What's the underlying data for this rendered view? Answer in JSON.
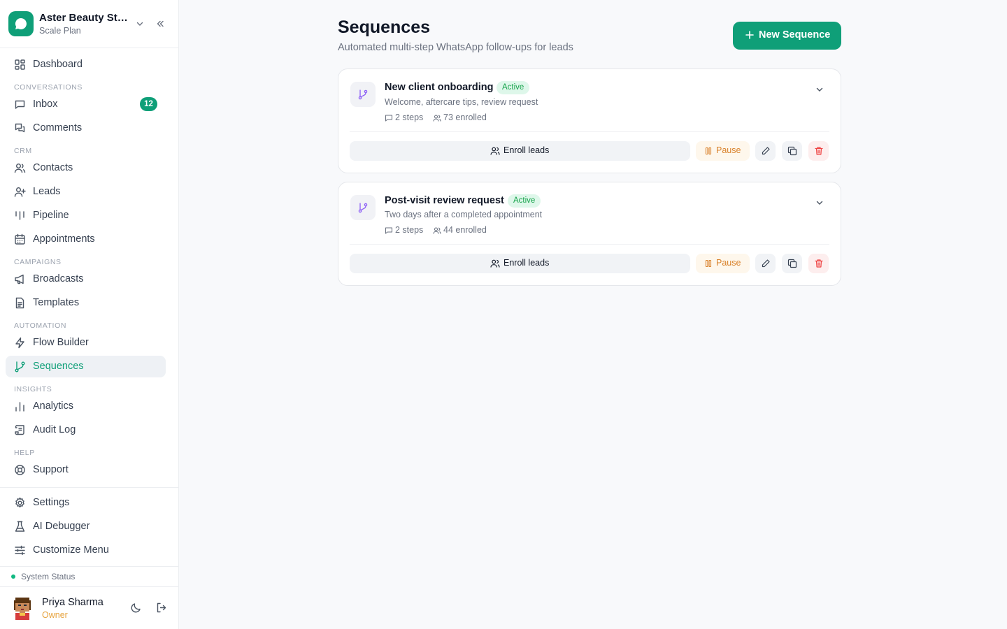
{
  "brand": {
    "name": "Aster Beauty Stu...",
    "plan": "Scale Plan"
  },
  "colors": {
    "accent": "#0f9f78",
    "active_badge_bg": "#def7ea",
    "active_badge_text": "#16a34a",
    "pause_text": "#d9822b",
    "danger": "#ef4444"
  },
  "nav": {
    "dashboard": "Dashboard",
    "section_conversations": "CONVERSATIONS",
    "inbox": "Inbox",
    "inbox_count": "12",
    "comments": "Comments",
    "section_crm": "CRM",
    "contacts": "Contacts",
    "leads": "Leads",
    "pipeline": "Pipeline",
    "appointments": "Appointments",
    "section_campaigns": "CAMPAIGNS",
    "broadcasts": "Broadcasts",
    "templates": "Templates",
    "section_automation": "AUTOMATION",
    "flow_builder": "Flow Builder",
    "sequences": "Sequences",
    "section_insights": "INSIGHTS",
    "analytics": "Analytics",
    "audit_log": "Audit Log",
    "section_help": "HELP",
    "support": "Support",
    "settings": "Settings",
    "ai_debugger": "AI Debugger",
    "customize_menu": "Customize Menu"
  },
  "system_status": "System Status",
  "user": {
    "name": "Priya Sharma",
    "role": "Owner"
  },
  "page": {
    "title": "Sequences",
    "subtitle": "Automated multi-step WhatsApp follow-ups for leads",
    "new_button": "New Sequence"
  },
  "sequences": [
    {
      "title": "New client onboarding",
      "status": "Active",
      "description": "Welcome, aftercare tips, review request",
      "steps": "2 steps",
      "enrolled": "73 enrolled",
      "enroll_label": "Enroll leads",
      "pause_label": "Pause"
    },
    {
      "title": "Post-visit review request",
      "status": "Active",
      "description": "Two days after a completed appointment",
      "steps": "2 steps",
      "enrolled": "44 enrolled",
      "enroll_label": "Enroll leads",
      "pause_label": "Pause"
    }
  ]
}
